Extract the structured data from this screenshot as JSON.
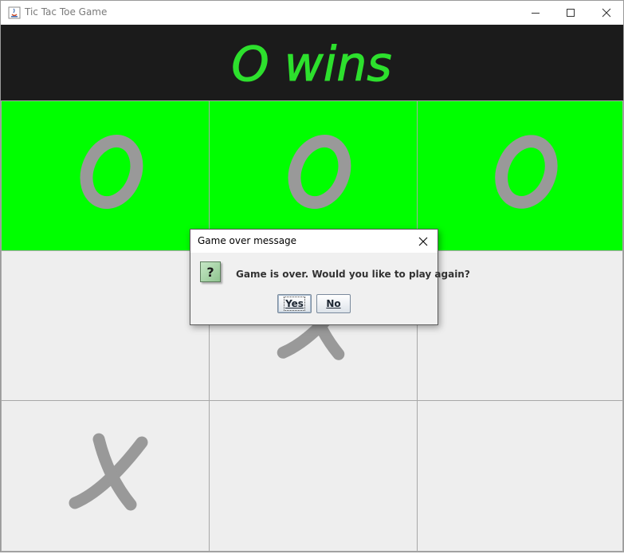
{
  "window": {
    "title": "Tic Tac Toe Game",
    "controls": [
      "minimize-icon",
      "maximize-icon",
      "close-icon"
    ]
  },
  "banner": {
    "text": "O wins",
    "background": "#1b1b1b",
    "text_color": "#2de02d"
  },
  "board": {
    "cells": [
      "O",
      "O",
      "O",
      "",
      "X",
      "",
      "X",
      "",
      ""
    ],
    "winning_cells": [
      0,
      1,
      2
    ],
    "win_color": "#00ff00",
    "cell_color": "#eeeeee",
    "mark_color": "#999999"
  },
  "dialog": {
    "title": "Game over message",
    "message": "Game is over. Would you like to play again?",
    "icon": "question-icon",
    "icon_glyph": "?",
    "yes_label": "Yes",
    "no_label": "No"
  }
}
